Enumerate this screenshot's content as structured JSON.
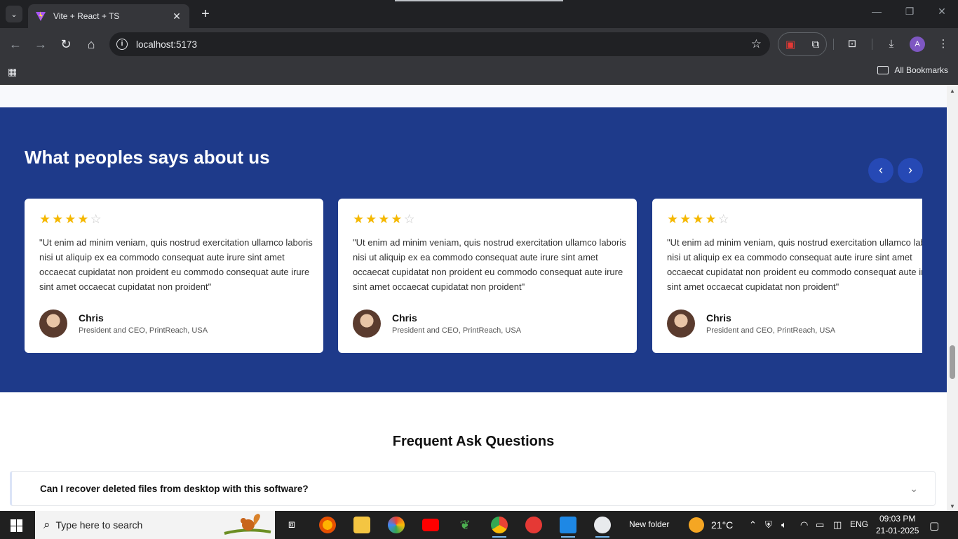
{
  "browser": {
    "tab_title": "Vite + React + TS",
    "url": "localhost:5173",
    "bookmarks_label": "All Bookmarks",
    "avatar_letter": "A"
  },
  "testimonials": {
    "heading": "What peoples says about us",
    "cards": [
      {
        "rating": 4,
        "max_rating": 5,
        "quote": "\"Ut enim ad minim veniam, quis nostrud exercitation ullamco laboris nisi ut aliquip ex ea commodo consequat aute irure sint amet occaecat cupidatat non proident eu commodo consequat aute irure sint amet occaecat cupidatat non proident\"",
        "name": "Chris",
        "role": "President and CEO, PrintReach, USA"
      },
      {
        "rating": 4,
        "max_rating": 5,
        "quote": "\"Ut enim ad minim veniam, quis nostrud exercitation ullamco laboris nisi ut aliquip ex ea commodo consequat aute irure sint amet occaecat cupidatat non proident eu commodo consequat aute irure sint amet occaecat cupidatat non proident\"",
        "name": "Chris",
        "role": "President and CEO, PrintReach, USA"
      },
      {
        "rating": 4,
        "max_rating": 5,
        "quote": "\"Ut enim ad minim veniam, quis nostrud exercitation ullamco laboris nisi ut aliquip ex ea commodo consequat aute irure sint amet occaecat cupidatat non proident eu commodo consequat aute irure sint amet occaecat cupidatat non proident\"",
        "name": "Chris",
        "role": "President and CEO, PrintReach, USA"
      }
    ]
  },
  "faq": {
    "heading": "Frequent Ask Questions",
    "items": [
      {
        "question": "Can I recover deleted files from desktop with this software?"
      }
    ]
  },
  "taskbar": {
    "search_placeholder": "Type here to search",
    "folder_label": "New folder",
    "weather": "21°C",
    "language": "ENG",
    "time": "09:03 PM",
    "date": "21-01-2025"
  },
  "colors": {
    "section_bg": "#1e3a8a",
    "star": "#f5b800",
    "arrow_btn": "#2649b5"
  }
}
